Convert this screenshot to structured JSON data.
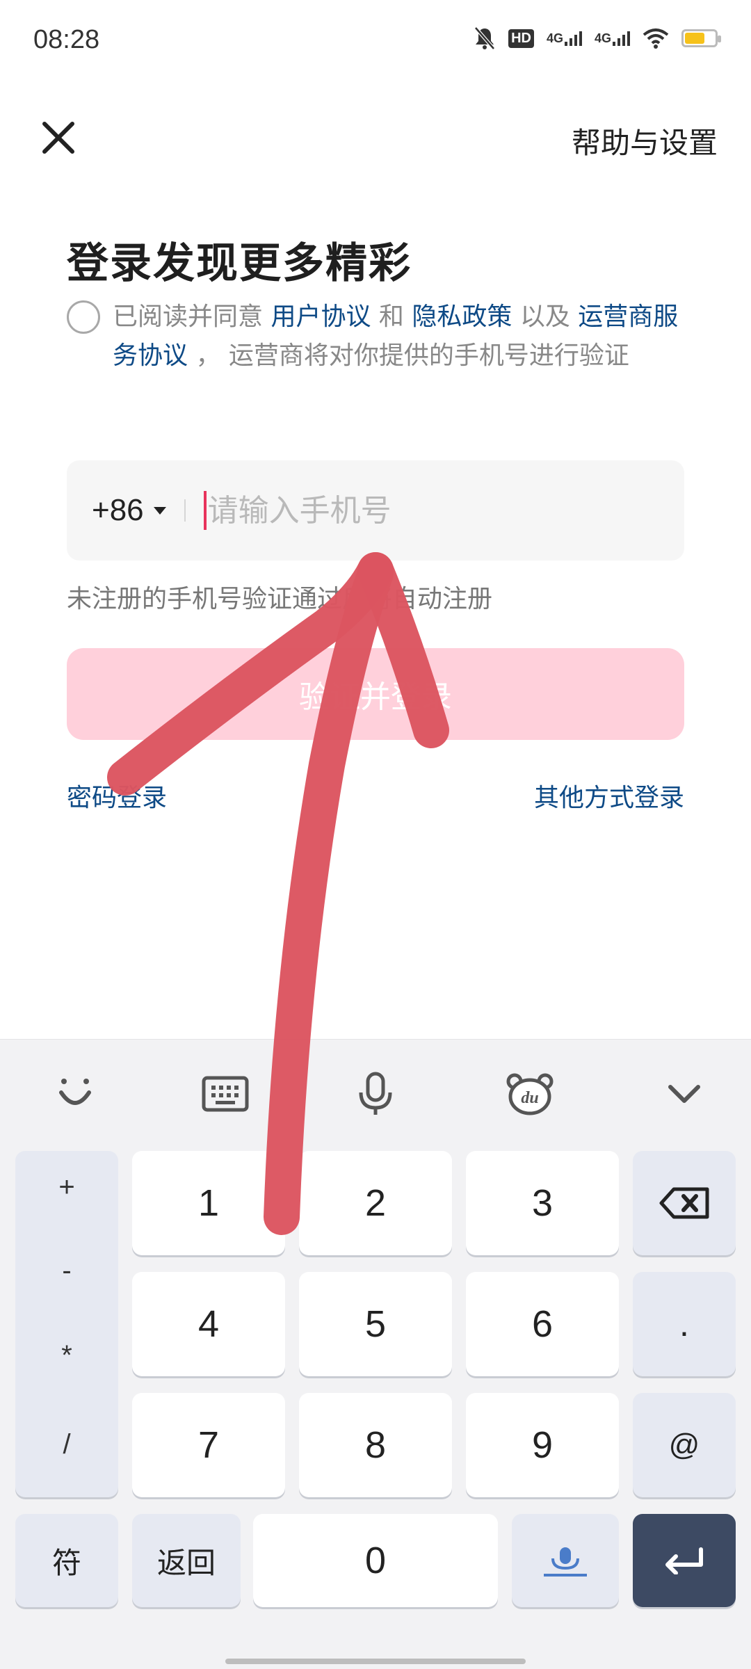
{
  "status_bar": {
    "time": "08:28",
    "hd_label": "HD",
    "net1": "4G",
    "net2": "4G",
    "battery_color": "#f6c21b"
  },
  "header": {
    "close_icon": "close-icon",
    "help_label": "帮助与设置"
  },
  "login": {
    "title": "登录发现更多精彩",
    "agreement": {
      "prefix": "已阅读并同意 ",
      "user_agreement": "用户协议",
      "and": " 和 ",
      "privacy_policy": "隐私政策",
      "and2": " 以及 ",
      "carrier_agreement": "运营商服务协议",
      "suffix": " ， 运营商将对你提供的手机号进行验证"
    },
    "country_code": "+86",
    "phone_placeholder": "请输入手机号",
    "hint": "未注册的手机号验证通过后将自动注册",
    "submit_label": "验证并登录",
    "password_login": "密码登录",
    "other_login": "其他方式登录",
    "link_color": "#0e4a86",
    "button_color": "#ffd0db"
  },
  "keyboard": {
    "toolbar_icons": [
      "smile-icon",
      "keyboard-icon",
      "microphone-icon",
      "bear-du-icon",
      "chevron-down-icon"
    ],
    "symbols": [
      "+",
      "-",
      "*",
      "/"
    ],
    "digits": [
      "1",
      "2",
      "3",
      "4",
      "5",
      "6",
      "7",
      "8",
      "9",
      "0"
    ],
    "dot": ".",
    "at": "@",
    "symbol_key": "符",
    "back_key": "返回"
  }
}
